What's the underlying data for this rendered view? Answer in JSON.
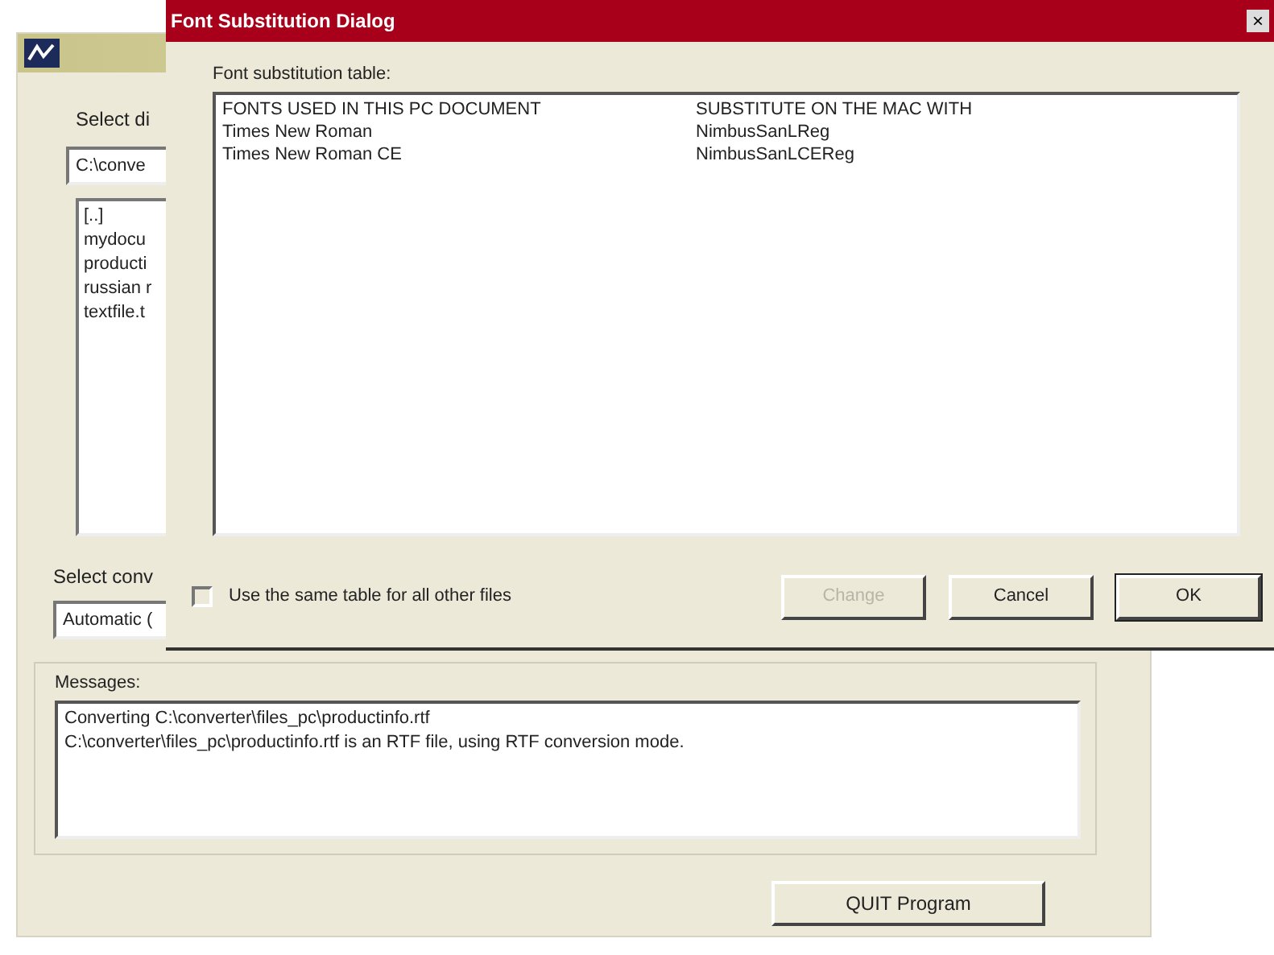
{
  "main_window": {
    "labels": {
      "directory": "Select di",
      "conversion": "Select conv",
      "messages": "Messages:"
    },
    "path_field": {
      "value": "C:\\conve"
    },
    "file_list": [
      "[..]",
      "mydocu",
      "producti",
      "russian r",
      "textfile.t"
    ],
    "conversion_dropdown": {
      "value": "Automatic ("
    },
    "messages": [
      "Converting C:\\converter\\files_pc\\productinfo.rtf",
      "C:\\converter\\files_pc\\productinfo.rtf is an RTF file, using RTF conversion mode."
    ],
    "quit_button": "QUIT Program"
  },
  "dialog": {
    "title": "Font Substitution Dialog",
    "close": "×",
    "table_label": "Font substitution table:",
    "table": {
      "columns": [
        "FONTS USED IN THIS PC DOCUMENT",
        "SUBSTITUTE ON THE MAC WITH"
      ],
      "rows": [
        [
          "Times New Roman",
          "NimbusSanLReg"
        ],
        [
          "Times New Roman CE",
          "NimbusSanLCEReg"
        ]
      ]
    },
    "same_table_checkbox": {
      "label": "Use the same table for all other files",
      "checked": false
    },
    "buttons": [
      {
        "label": "Change",
        "disabled": true,
        "default": false
      },
      {
        "label": "Cancel",
        "disabled": false,
        "default": false
      },
      {
        "label": "OK",
        "disabled": false,
        "default": true
      }
    ]
  }
}
